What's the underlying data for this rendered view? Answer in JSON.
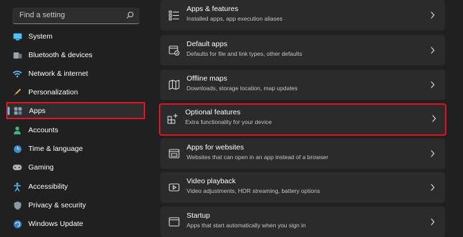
{
  "search": {
    "placeholder": "Find a setting"
  },
  "sidebar": {
    "items": [
      {
        "label": "System",
        "icon": "monitor-icon"
      },
      {
        "label": "Bluetooth & devices",
        "icon": "bluetooth-icon"
      },
      {
        "label": "Network & internet",
        "icon": "wifi-icon"
      },
      {
        "label": "Personalization",
        "icon": "brush-icon"
      },
      {
        "label": "Apps",
        "icon": "apps-icon",
        "selected": true
      },
      {
        "label": "Accounts",
        "icon": "person-icon"
      },
      {
        "label": "Time & language",
        "icon": "globe-clock-icon"
      },
      {
        "label": "Gaming",
        "icon": "gamepad-icon"
      },
      {
        "label": "Accessibility",
        "icon": "accessibility-icon"
      },
      {
        "label": "Privacy & security",
        "icon": "shield-icon"
      },
      {
        "label": "Windows Update",
        "icon": "update-icon"
      }
    ]
  },
  "main": {
    "cards": [
      {
        "title": "Apps & features",
        "subtitle": "Installed apps, app execution aliases",
        "icon": "apps-list-icon"
      },
      {
        "title": "Default apps",
        "subtitle": "Defaults for file and link types, other defaults",
        "icon": "default-apps-icon"
      },
      {
        "title": "Offline maps",
        "subtitle": "Downloads, storage location, map updates",
        "icon": "map-icon"
      },
      {
        "title": "Optional features",
        "subtitle": "Extra functionality for your device",
        "icon": "add-grid-icon",
        "highlighted": true
      },
      {
        "title": "Apps for websites",
        "subtitle": "Websites that can open in an app instead of a browser",
        "icon": "web-app-icon"
      },
      {
        "title": "Video playback",
        "subtitle": "Video adjustments, HDR streaming, battery options",
        "icon": "video-icon"
      },
      {
        "title": "Startup",
        "subtitle": "Apps that start automatically when you sign in",
        "icon": "startup-icon"
      }
    ]
  },
  "colors": {
    "background": "#202020",
    "card": "#2b2b2b",
    "accent": "#4cc2ff",
    "highlight_border": "#e81123"
  }
}
